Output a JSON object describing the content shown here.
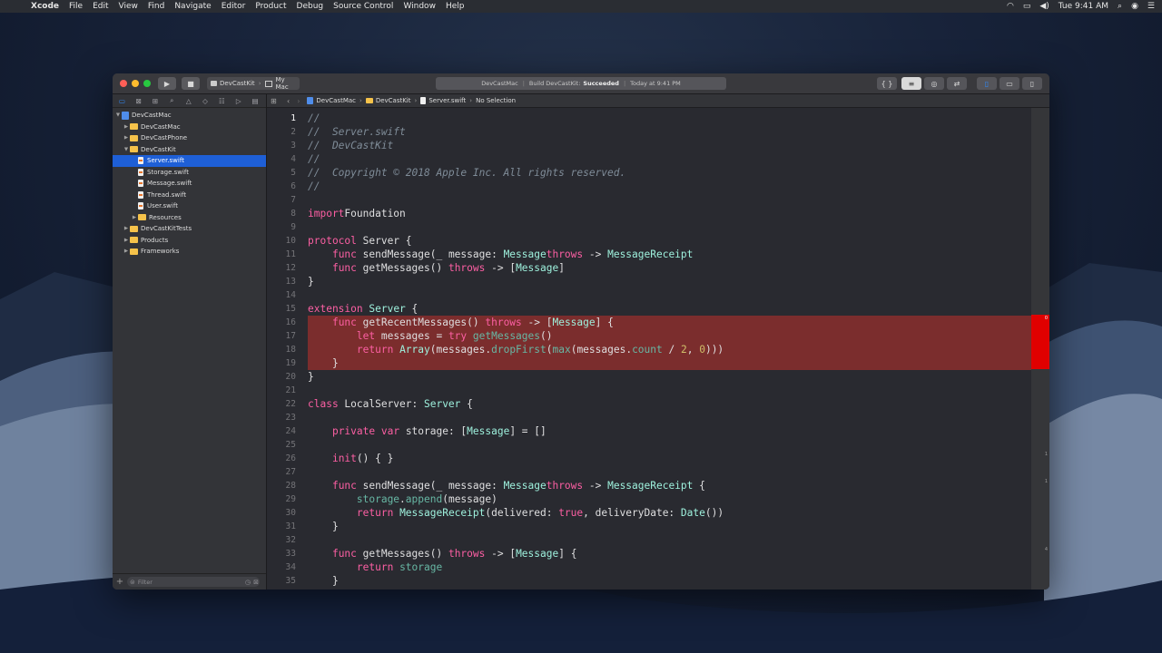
{
  "menubar": {
    "app": "Xcode",
    "items": [
      "File",
      "Edit",
      "View",
      "Find",
      "Navigate",
      "Editor",
      "Product",
      "Debug",
      "Source Control",
      "Window",
      "Help"
    ],
    "clock": "Tue 9:41 AM"
  },
  "toolbar": {
    "scheme": "DevCastKit",
    "destination": "My Mac",
    "activity": {
      "project": "DevCastMac",
      "status_prefix": "Build DevCastKit:",
      "status": "Succeeded",
      "time": "Today at 9:41 PM"
    },
    "editor_mode_icons": [
      "{ }",
      "standard-editor-icon",
      "assistant-editor-icon",
      "version-editor-icon"
    ],
    "panel_icons": [
      "navigator-panel-icon",
      "debug-panel-icon",
      "inspector-panel-icon"
    ]
  },
  "navigator": {
    "tree": [
      {
        "label": "DevCastMac",
        "kind": "project",
        "depth": 0,
        "expanded": true
      },
      {
        "label": "DevCastMac",
        "kind": "folder",
        "depth": 1,
        "expanded": false
      },
      {
        "label": "DevCastPhone",
        "kind": "folder",
        "depth": 1,
        "expanded": false
      },
      {
        "label": "DevCastKit",
        "kind": "folder",
        "depth": 1,
        "expanded": true
      },
      {
        "label": "Server.swift",
        "kind": "file",
        "depth": 2,
        "selected": true
      },
      {
        "label": "Storage.swift",
        "kind": "file",
        "depth": 2
      },
      {
        "label": "Message.swift",
        "kind": "file",
        "depth": 2
      },
      {
        "label": "Thread.swift",
        "kind": "file",
        "depth": 2
      },
      {
        "label": "User.swift",
        "kind": "file",
        "depth": 2
      },
      {
        "label": "Resources",
        "kind": "folder",
        "depth": 2,
        "expanded": false
      },
      {
        "label": "DevCastKitTests",
        "kind": "folder",
        "depth": 1,
        "expanded": false
      },
      {
        "label": "Products",
        "kind": "folder",
        "depth": 1,
        "expanded": false
      },
      {
        "label": "Frameworks",
        "kind": "folder",
        "depth": 1,
        "expanded": false
      }
    ],
    "filter_placeholder": "Filter"
  },
  "jumpbar": {
    "path": [
      "DevCastMac",
      "DevCastKit",
      "Server.swift"
    ],
    "selection": "No Selection"
  },
  "editor": {
    "current_line": 1,
    "highlight_lines": [
      16,
      17,
      18,
      19
    ],
    "lines": [
      {
        "n": "1",
        "t": [
          [
            "cm",
            "//"
          ]
        ]
      },
      {
        "n": "2",
        "t": [
          [
            "cm",
            "//  Server.swift"
          ]
        ]
      },
      {
        "n": "3",
        "t": [
          [
            "cm",
            "//  DevCastKit"
          ]
        ]
      },
      {
        "n": "4",
        "t": [
          [
            "cm",
            "//"
          ]
        ]
      },
      {
        "n": "5",
        "t": [
          [
            "cm",
            "//  Copyright © 2018 Apple Inc. All rights reserved."
          ]
        ]
      },
      {
        "n": "6",
        "t": [
          [
            "cm",
            "//"
          ]
        ]
      },
      {
        "n": "7",
        "t": []
      },
      {
        "n": "8",
        "t": [
          [
            "kw",
            "import"
          ],
          [
            "",
            "Foundation"
          ]
        ]
      },
      {
        "n": "9",
        "t": []
      },
      {
        "n": "10",
        "t": [
          [
            "kw",
            "protocol"
          ],
          [
            "",
            " Server {"
          ]
        ]
      },
      {
        "n": "11",
        "t": [
          [
            "",
            "    "
          ],
          [
            "kw",
            "func"
          ],
          [
            "",
            " sendMessage(_ message: "
          ],
          [
            "ty",
            "Message"
          ],
          [
            ") "
          ],
          [
            "kw",
            "throws"
          ],
          [
            "",
            " -> "
          ],
          [
            "ty",
            "MessageReceipt"
          ]
        ]
      },
      {
        "n": "12",
        "t": [
          [
            "",
            "    "
          ],
          [
            "kw",
            "func"
          ],
          [
            "",
            " getMessages() "
          ],
          [
            "kw",
            "throws"
          ],
          [
            "",
            " -> ["
          ],
          [
            "ty",
            "Message"
          ],
          [
            "",
            "]"
          ]
        ]
      },
      {
        "n": "13",
        "t": [
          [
            "",
            "}"
          ]
        ]
      },
      {
        "n": "14",
        "t": []
      },
      {
        "n": "15",
        "t": [
          [
            "kw",
            "extension"
          ],
          [
            "",
            " "
          ],
          [
            "ty",
            "Server"
          ],
          [
            "",
            " {"
          ]
        ]
      },
      {
        "n": "16",
        "t": [
          [
            "",
            "    "
          ],
          [
            "kw",
            "func"
          ],
          [
            "",
            " getRecentMessages() "
          ],
          [
            "kw",
            "throws"
          ],
          [
            "",
            " -> ["
          ],
          [
            "ty",
            "Message"
          ],
          [
            "",
            "] {"
          ]
        ]
      },
      {
        "n": "17",
        "t": [
          [
            "",
            "        "
          ],
          [
            "kw",
            "let"
          ],
          [
            "",
            " messages = "
          ],
          [
            "kw",
            "try"
          ],
          [
            "",
            " "
          ],
          [
            "fn",
            "getMessages"
          ],
          [
            "",
            "()"
          ]
        ]
      },
      {
        "n": "18",
        "t": [
          [
            "",
            "        "
          ],
          [
            "kw",
            "return"
          ],
          [
            "",
            " "
          ],
          [
            "ty",
            "Array"
          ],
          [
            "",
            "(messages."
          ],
          [
            "fn",
            "dropFirst"
          ],
          [
            "",
            "("
          ],
          [
            "fn",
            "max"
          ],
          [
            "",
            "(messages."
          ],
          [
            "fn",
            "count"
          ],
          [
            "",
            " / "
          ],
          [
            "num-lit",
            "2"
          ],
          [
            "",
            ", "
          ],
          [
            "num-lit",
            "0"
          ],
          [
            "",
            ")))"
          ]
        ]
      },
      {
        "n": "19",
        "t": [
          [
            "",
            "    }"
          ]
        ]
      },
      {
        "n": "20",
        "t": [
          [
            "",
            "}"
          ]
        ]
      },
      {
        "n": "21",
        "t": []
      },
      {
        "n": "22",
        "t": [
          [
            "kw",
            "class"
          ],
          [
            "",
            " LocalServer: "
          ],
          [
            "ty",
            "Server"
          ],
          [
            "",
            " {"
          ]
        ]
      },
      {
        "n": "23",
        "t": []
      },
      {
        "n": "24",
        "t": [
          [
            "",
            "    "
          ],
          [
            "kw",
            "private"
          ],
          [
            "",
            " "
          ],
          [
            "kw",
            "var"
          ],
          [
            "",
            " storage: ["
          ],
          [
            "ty",
            "Message"
          ],
          [
            "",
            "] = []"
          ]
        ]
      },
      {
        "n": "25",
        "t": []
      },
      {
        "n": "26",
        "t": [
          [
            "",
            "    "
          ],
          [
            "kw",
            "init"
          ],
          [
            "",
            "() { }"
          ]
        ]
      },
      {
        "n": "27",
        "t": []
      },
      {
        "n": "28",
        "t": [
          [
            "",
            "    "
          ],
          [
            "kw",
            "func"
          ],
          [
            "",
            " sendMessage(_ message: "
          ],
          [
            "ty",
            "Message"
          ],
          [
            ") "
          ],
          [
            "kw",
            "throws"
          ],
          [
            "",
            " -> "
          ],
          [
            "ty",
            "MessageReceipt"
          ],
          [
            "",
            " {"
          ]
        ]
      },
      {
        "n": "29",
        "t": [
          [
            "",
            "        "
          ],
          [
            "fn",
            "storage"
          ],
          [
            "",
            "."
          ],
          [
            "fn",
            "append"
          ],
          [
            "",
            "(message)"
          ]
        ]
      },
      {
        "n": "30",
        "t": [
          [
            "",
            "        "
          ],
          [
            "kw",
            "return"
          ],
          [
            "",
            " "
          ],
          [
            "ty",
            "MessageReceipt"
          ],
          [
            "",
            "(delivered: "
          ],
          [
            "kw",
            "true"
          ],
          [
            "",
            ", deliveryDate: "
          ],
          [
            "ty",
            "Date"
          ],
          [
            "",
            "())"
          ]
        ]
      },
      {
        "n": "31",
        "t": [
          [
            "",
            "    }"
          ]
        ]
      },
      {
        "n": "32",
        "t": []
      },
      {
        "n": "33",
        "t": [
          [
            "",
            "    "
          ],
          [
            "kw",
            "func"
          ],
          [
            "",
            " getMessages() "
          ],
          [
            "kw",
            "throws"
          ],
          [
            "",
            " -> ["
          ],
          [
            "ty",
            "Message"
          ],
          [
            "",
            "] {"
          ]
        ]
      },
      {
        "n": "34",
        "t": [
          [
            "",
            "        "
          ],
          [
            "kw",
            "return"
          ],
          [
            "",
            " "
          ],
          [
            "fn",
            "storage"
          ]
        ]
      },
      {
        "n": "35",
        "t": [
          [
            "",
            "    }"
          ]
        ]
      }
    ]
  },
  "minimap": {
    "error_marker": "0",
    "marks": [
      "1",
      "1",
      "4"
    ]
  }
}
